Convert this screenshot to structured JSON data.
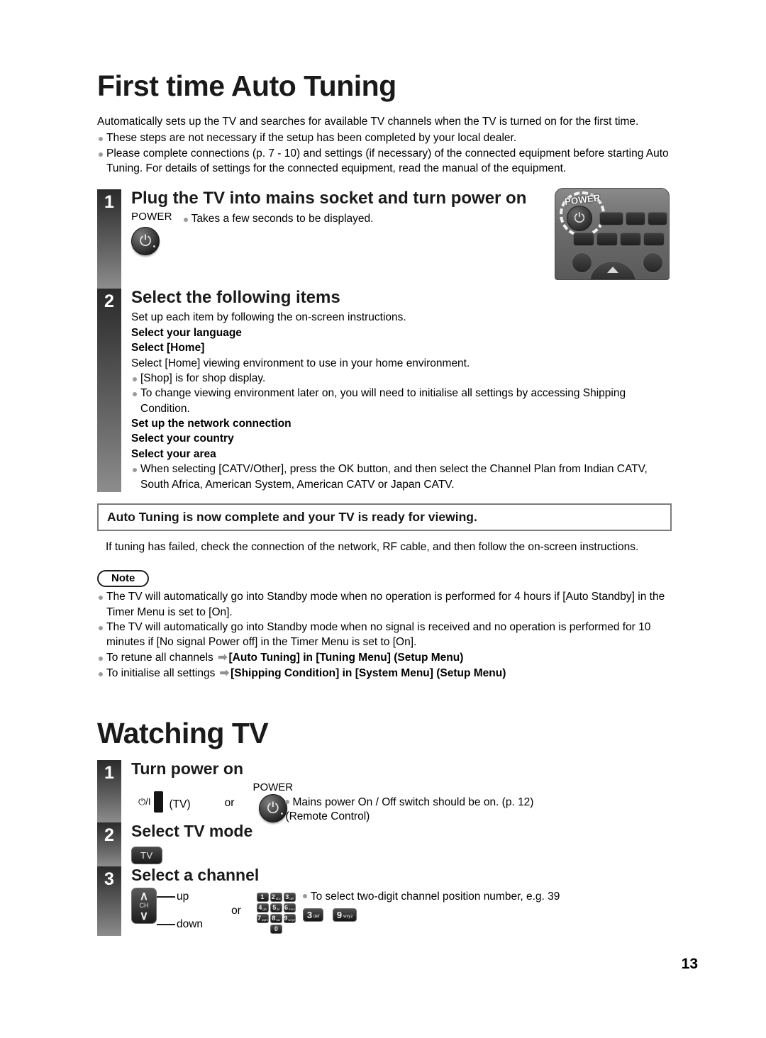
{
  "document": {
    "page_number": "13"
  },
  "section1": {
    "title": "First time Auto Tuning",
    "intro": "Automatically sets up the TV and searches for available TV channels when the TV is turned on for the first time.",
    "intro_bullets": [
      "These steps are not necessary if the setup has been completed by your local dealer.",
      "Please complete connections (p. 7 - 10) and settings (if necessary) of the connected equipment before starting Auto Tuning. For details of settings for the connected equipment, read the manual of the equipment."
    ],
    "step1": {
      "number": "1",
      "title": "Plug the TV into mains socket and turn power on",
      "power_label": "POWER",
      "note": "Takes a few seconds to be displayed.",
      "remote": {
        "power_label": "POWER",
        "power_glyph": "⏻"
      }
    },
    "step2": {
      "number": "2",
      "title": "Select the following items",
      "lead": "Set up each item by following the on-screen instructions.",
      "items": [
        {
          "type": "bold",
          "text": "Select your language"
        },
        {
          "type": "bold",
          "text": "Select [Home]"
        },
        {
          "type": "plain",
          "text": "Select [Home] viewing environment to use in your home environment."
        },
        {
          "type": "bullet",
          "text": "[Shop] is for shop display."
        },
        {
          "type": "bullet",
          "text": "To change viewing environment later on, you will need to initialise all settings by accessing Shipping Condition."
        },
        {
          "type": "bold",
          "text": "Set up the network connection"
        },
        {
          "type": "bold",
          "text": "Select your country"
        },
        {
          "type": "bold",
          "text": "Select your area"
        },
        {
          "type": "bullet",
          "text": "When selecting [CATV/Other], press the OK button, and then select the Channel Plan from Indian CATV, South Africa, American System, American CATV or Japan CATV."
        }
      ]
    },
    "callout": {
      "heading": "Auto Tuning is now complete and your TV is ready for viewing.",
      "sub": "If tuning has failed, check the connection of the network, RF cable, and then follow the on-screen instructions."
    },
    "note": {
      "label": "Note",
      "items": [
        {
          "kind": "plain",
          "text": "The TV will automatically go into Standby mode when no operation is performed for 4 hours if [Auto Standby] in the Timer Menu is set to [On]."
        },
        {
          "kind": "plain",
          "text": "The TV will automatically go into Standby mode when no signal is received and no operation is performed for 10 minutes if [No signal Power off] in the Timer Menu is set to [On]."
        },
        {
          "kind": "arrow",
          "text": "To retune all channels ",
          "bold": "[Auto Tuning] in [Tuning Menu] (Setup Menu)"
        },
        {
          "kind": "arrow",
          "text": "To initialise all settings ",
          "bold": "[Shipping Condition] in [System Menu] (Setup Menu)"
        }
      ]
    }
  },
  "section2": {
    "title": "Watching TV",
    "step1": {
      "number": "1",
      "title": "Turn power on",
      "tv_symbol": "⏻/I",
      "tv_caption": "(TV)",
      "or": "or",
      "power_label": "POWER",
      "power_glyph": "⏻",
      "note": "Mains power On / Off switch should be on. (p. 12)",
      "note2": "(Remote Control)"
    },
    "step2": {
      "number": "2",
      "title": "Select TV mode",
      "key_label": "TV"
    },
    "step3": {
      "number": "3",
      "title": "Select a channel",
      "ch_label": "CH",
      "up_label": "up",
      "down_label": "down",
      "or": "or",
      "note": "To select two-digit channel position number, e.g. 39",
      "keypad": [
        {
          "num": "1",
          "sub": ""
        },
        {
          "num": "2",
          "sub": "abc"
        },
        {
          "num": "3",
          "sub": "def"
        },
        {
          "num": "4",
          "sub": "ghi"
        },
        {
          "num": "5",
          "sub": "jkl"
        },
        {
          "num": "6",
          "sub": "mno"
        },
        {
          "num": "7",
          "sub": "pqrs"
        },
        {
          "num": "8",
          "sub": "tuv"
        },
        {
          "num": "9",
          "sub": "wxyz"
        },
        {
          "num": "0",
          "sub": ""
        }
      ],
      "example_keys": [
        {
          "num": "3",
          "sub": "def"
        },
        {
          "num": "9",
          "sub": "wxyz"
        }
      ]
    }
  }
}
